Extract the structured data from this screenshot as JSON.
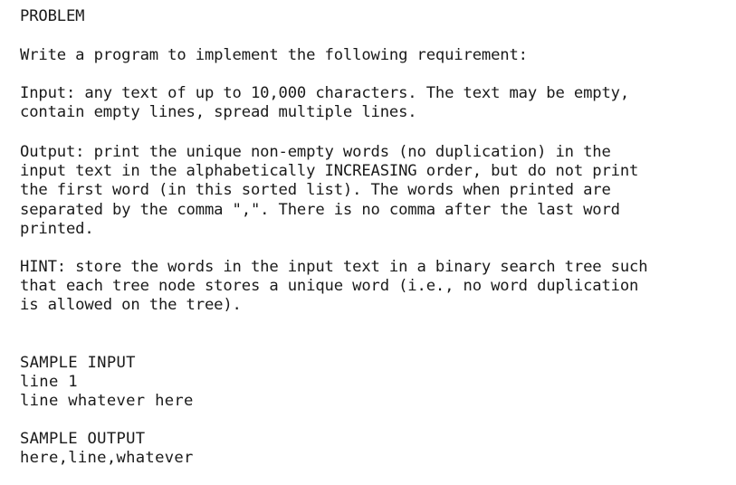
{
  "document": {
    "heading": "PROBLEM",
    "intro": "Write a program to implement the following requirement:",
    "input_paragraph": [
      "Input: any text of up to 10,000 characters. The text may be empty,",
      "contain empty lines, spread multiple lines."
    ],
    "output_paragraph": [
      "Output: print the unique non-empty words (no duplication) in the",
      "input text in the alphabetically INCREASING order, but do not print",
      "the first word (in this sorted list). The words when printed are",
      "separated by the comma \",\". There is no comma after the last word",
      "printed."
    ],
    "hint_paragraph": [
      "HINT: store the words in the input text in a binary search tree such",
      "that each tree node stores a unique word (i.e., no word duplication",
      "is allowed on the tree)."
    ],
    "sample_input": {
      "label": "SAMPLE INPUT",
      "lines": [
        "line 1",
        "line whatever here"
      ]
    },
    "sample_output": {
      "label": "SAMPLE OUTPUT",
      "lines": [
        "here,line,whatever"
      ]
    }
  }
}
